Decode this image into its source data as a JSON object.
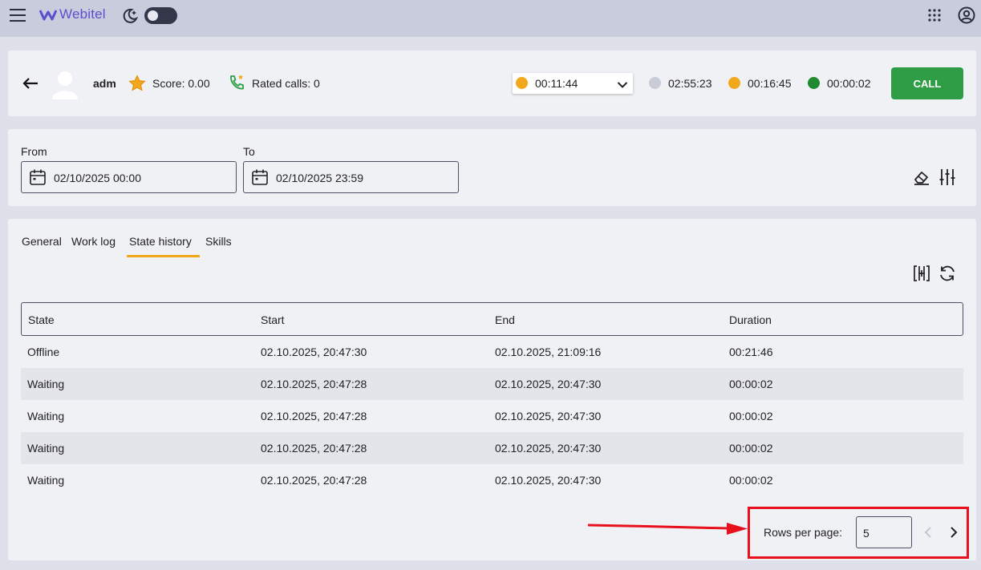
{
  "header": {
    "logo_text": "Webitel"
  },
  "agent": {
    "name": "adm",
    "score": "Score: 0.00",
    "rated_calls": "Rated calls: 0",
    "status_select_value": "00:11:44",
    "timers": [
      {
        "value": "02:55:23",
        "color": "#c8cbd8"
      },
      {
        "value": "00:16:45",
        "color": "#f2a81d"
      },
      {
        "value": "00:00:02",
        "color": "#1f8a2f"
      }
    ],
    "status_select_color": "#f2a81d",
    "call_label": "CALL"
  },
  "filters": {
    "from_label": "From",
    "from_value": "02/10/2025 00:00",
    "to_label": "To",
    "to_value": "02/10/2025 23:59"
  },
  "tabs": [
    "General",
    "Work log",
    "State history",
    "Skills"
  ],
  "active_tab": "State history",
  "table": {
    "columns": [
      "State",
      "Start",
      "End",
      "Duration"
    ],
    "rows": [
      [
        "Offline",
        "02.10.2025, 20:47:30",
        "02.10.2025, 21:09:16",
        "00:21:46"
      ],
      [
        "Waiting",
        "02.10.2025, 20:47:28",
        "02.10.2025, 20:47:30",
        "00:00:02"
      ],
      [
        "Waiting",
        "02.10.2025, 20:47:28",
        "02.10.2025, 20:47:30",
        "00:00:02"
      ],
      [
        "Waiting",
        "02.10.2025, 20:47:28",
        "02.10.2025, 20:47:30",
        "00:00:02"
      ],
      [
        "Waiting",
        "02.10.2025, 20:47:28",
        "02.10.2025, 20:47:30",
        "00:00:02"
      ]
    ]
  },
  "pagination": {
    "rows_per_page_label": "Rows per page:",
    "rows_per_page_value": "5"
  },
  "colors": {
    "accent": "#f0a818",
    "call_button": "#2e9d46",
    "annotation": "#e8101c"
  },
  "icons": [
    "menu-icon",
    "webitel-logo-icon",
    "night-mode-icon",
    "apps-grid-icon",
    "account-icon",
    "back-arrow-icon",
    "avatar-icon",
    "star-icon",
    "phone-star-icon",
    "chevron-down-icon",
    "calendar-icon",
    "eraser-icon",
    "sliders-icon",
    "column-settings-icon",
    "refresh-icon",
    "chevron-left-icon",
    "chevron-right-icon"
  ]
}
